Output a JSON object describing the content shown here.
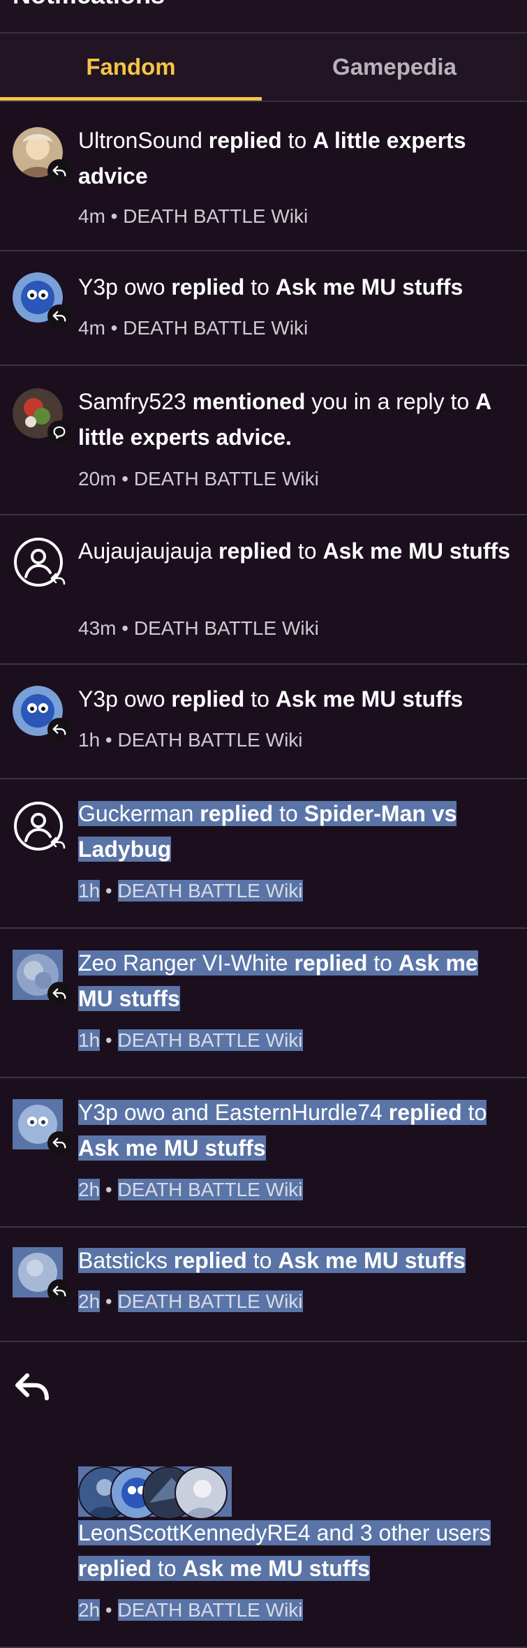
{
  "header": {
    "title": "Notifications"
  },
  "tabs": [
    {
      "label": "Fandom",
      "active": true
    },
    {
      "label": "Gamepedia",
      "active": false
    }
  ],
  "colors": {
    "background": "#1b0f1e",
    "accent": "#f6c445",
    "selection": "#5a74a7"
  },
  "notifications": [
    {
      "user": "UltronSound",
      "action": "replied",
      "mid": " to ",
      "target": "A little experts advice",
      "end": "",
      "time": "4m",
      "sep": " • ",
      "wiki": "DEATH BATTLE Wiki",
      "icon": "reply-icon"
    },
    {
      "user": "Y3p owo",
      "action": "replied",
      "mid": " to ",
      "target": "Ask me MU stuffs",
      "end": "",
      "time": "4m",
      "sep": " • ",
      "wiki": "DEATH BATTLE Wiki",
      "icon": "reply-icon"
    },
    {
      "user": "Samfry523",
      "action": "mentioned",
      "mid": " you in a reply to ",
      "target": "A little experts advice",
      "end": ".",
      "time": "20m",
      "sep": " • ",
      "wiki": "DEATH BATTLE Wiki",
      "icon": "comment-icon"
    },
    {
      "user": "Aujaujaujauja",
      "action": "replied",
      "mid": " to ",
      "target": "Ask me MU stuffs",
      "end": "",
      "time": "43m",
      "sep": " • ",
      "wiki": "DEATH BATTLE Wiki",
      "icon": "reply-icon"
    },
    {
      "user": "Y3p owo",
      "action": "replied",
      "mid": " to ",
      "target": "Ask me MU stuffs",
      "end": "",
      "time": "1h",
      "sep": " • ",
      "wiki": "DEATH BATTLE Wiki",
      "icon": "reply-icon"
    },
    {
      "user": "Guckerman",
      "action": "replied",
      "mid": " to ",
      "target": "Spider-Man vs Ladybug",
      "end": "",
      "time": "1h",
      "sep": " • ",
      "wiki": "DEATH BATTLE Wiki",
      "icon": "reply-icon"
    },
    {
      "user": "Zeo Ranger VI-White",
      "action": "replied",
      "mid": " to ",
      "target": "Ask me MU stuffs",
      "end": "",
      "time": "1h",
      "sep": " • ",
      "wiki": "DEATH BATTLE Wiki",
      "icon": "reply-icon"
    },
    {
      "user": "Y3p owo and EasternHurdle74",
      "action": "replied",
      "mid": " to ",
      "target": "Ask me MU stuffs",
      "end": "",
      "time": "2h",
      "sep": " • ",
      "wiki": "DEATH BATTLE Wiki",
      "icon": "reply-icon"
    },
    {
      "user": "Batsticks",
      "action": "replied",
      "mid": " to ",
      "target": "Ask me MU stuffs",
      "end": "",
      "time": "2h",
      "sep": " • ",
      "wiki": "DEATH BATTLE Wiki",
      "icon": "reply-icon"
    },
    {
      "user": "LeonScottKennedyRE4 and 3 other users",
      "action": "replied",
      "mid": " to ",
      "target": "Ask me MU stuffs",
      "end": "",
      "time": "2h",
      "sep": " • ",
      "wiki": "DEATH BATTLE Wiki",
      "icon": "reply-icon"
    }
  ]
}
